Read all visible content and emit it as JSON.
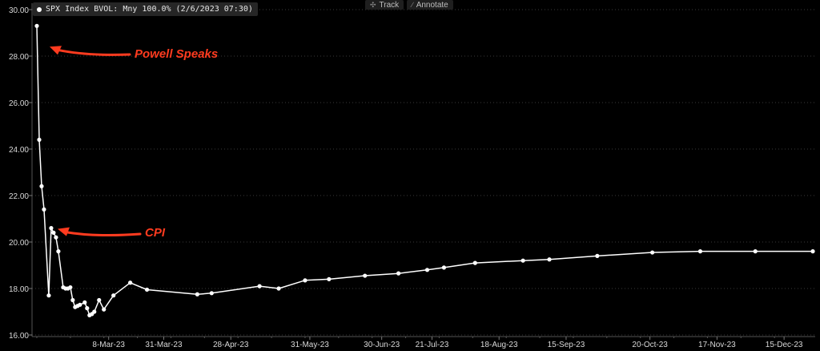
{
  "legend": {
    "text": "SPX Index BVOL: Mny 100.0% (2/6/2023 07:30)"
  },
  "toolbar": {
    "track_label": "Track",
    "annotate_label": "Annotate"
  },
  "annotations": [
    {
      "text": "Powell Speaks",
      "target_x": 0,
      "target_y": 29.3
    },
    {
      "text": "CPI",
      "target_x": 6,
      "target_y": 20.6
    }
  ],
  "colors": {
    "background": "#000000",
    "line": "#ffffff",
    "annotation": "#ff3b1f",
    "grid": "#3a3a3a"
  },
  "chart_data": {
    "type": "line",
    "title": "",
    "xlabel": "",
    "ylabel": "",
    "ylim": [
      16,
      30
    ],
    "xlim": [
      -2,
      325
    ],
    "x_units": "days since 2023-02-06",
    "y_ticks": [
      "16.00",
      "18.00",
      "20.00",
      "22.00",
      "24.00",
      "26.00",
      "28.00",
      "30.00"
    ],
    "x_ticks": [
      {
        "label": "8-Mar-23",
        "x": 30
      },
      {
        "label": "31-Mar-23",
        "x": 53
      },
      {
        "label": "28-Apr-23",
        "x": 81
      },
      {
        "label": "31-May-23",
        "x": 114
      },
      {
        "label": "30-Jun-23",
        "x": 144
      },
      {
        "label": "21-Jul-23",
        "x": 165
      },
      {
        "label": "18-Aug-23",
        "x": 193
      },
      {
        "label": "15-Sep-23",
        "x": 221
      },
      {
        "label": "20-Oct-23",
        "x": 256
      },
      {
        "label": "17-Nov-23",
        "x": 284
      },
      {
        "label": "15-Dec-23",
        "x": 312
      }
    ],
    "grid": "horizontal dashed",
    "series": [
      {
        "name": "SPX Index BVOL: Mny 100.0%",
        "x": [
          0,
          1,
          2,
          3,
          5,
          6,
          7,
          8,
          9,
          11,
          12,
          13,
          14,
          15,
          16,
          17,
          18,
          20,
          21,
          22,
          23,
          24,
          26,
          28,
          32,
          39,
          46,
          67,
          73,
          93,
          101,
          112,
          122,
          137,
          151,
          163,
          170,
          183,
          203,
          214,
          234,
          257,
          277,
          300,
          324
        ],
        "values": [
          29.3,
          24.4,
          22.4,
          21.4,
          17.7,
          20.6,
          20.4,
          20.2,
          19.6,
          18.05,
          18.0,
          18.0,
          18.05,
          17.5,
          17.2,
          17.25,
          17.3,
          17.4,
          17.15,
          16.85,
          16.9,
          17.0,
          17.5,
          17.1,
          17.7,
          18.25,
          17.95,
          17.75,
          17.8,
          18.1,
          18.0,
          18.35,
          18.4,
          18.55,
          18.65,
          18.8,
          18.9,
          19.1,
          19.2,
          19.25,
          19.4,
          19.55,
          19.6,
          19.6,
          19.6
        ]
      }
    ]
  }
}
